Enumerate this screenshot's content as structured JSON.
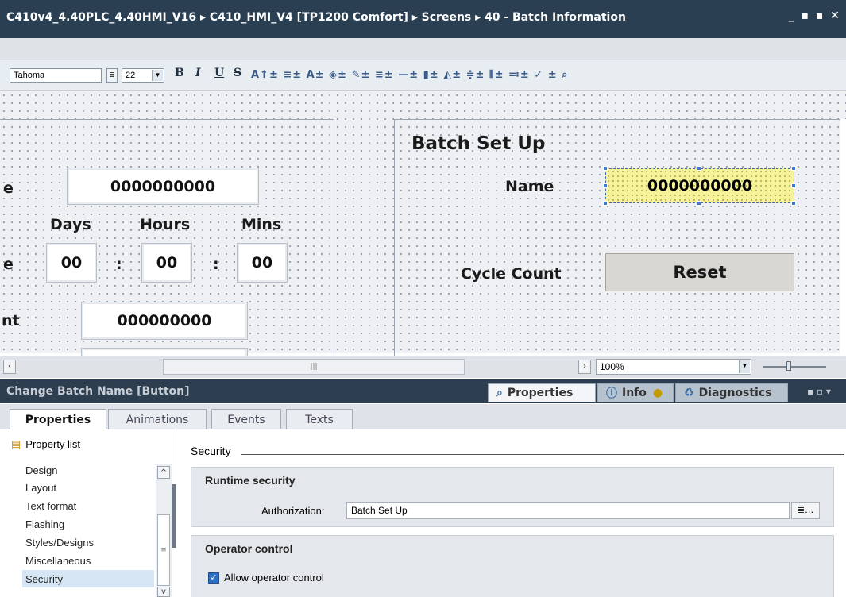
{
  "title_bar": {
    "path": "C410v4_4.40PLC_4.40HMI_V16  ▸  C410_HMI_V4 [TP1200 Comfort]  ▸  Screens  ▸  40 - Batch Information",
    "window_controls": "_ ▪ ▪ ✕"
  },
  "toolbar": {
    "font_name": "Tahoma",
    "font_size": "22",
    "bold": "B",
    "italic": "I",
    "underline": "U",
    "strike": "S",
    "more_icons": "A↑±  ≡±  A±  ◈±  ✎±  ≡±  —±  ▮±  ◭±  ≑±  ⦀±  ≕±  ✓  ±  ⌕"
  },
  "canvas": {
    "left_panel": {
      "cut_label_1": "e",
      "cut_label_2": "e",
      "cut_label_3": "nt",
      "name_value": "0000000000",
      "days_label": "Days",
      "hours_label": "Hours",
      "mins_label": "Mins",
      "days_value": "00",
      "hours_value": "00",
      "mins_value": "00",
      "sep": ":",
      "count_value": "000000000"
    },
    "right_panel": {
      "heading": "Batch Set Up",
      "name_label": "Name",
      "name_value": "0000000000",
      "cycle_label": "Cycle Count",
      "reset_label": "Reset"
    }
  },
  "scroll": {
    "zoom": "100%"
  },
  "properties_header": {
    "title": "Change Batch Name [Button]",
    "tab_properties": "Properties",
    "tab_info": "Info",
    "tab_diagnostics": "Diagnostics"
  },
  "sub_tabs": [
    "Properties",
    "Animations",
    "Events",
    "Texts"
  ],
  "nav": {
    "property_list": "Property list",
    "items": [
      "Design",
      "Layout",
      "Text format",
      "Flashing",
      "Styles/Designs",
      "Miscellaneous",
      "Security"
    ]
  },
  "security": {
    "section_title": "Security",
    "runtime_title": "Runtime security",
    "auth_label": "Authorization:",
    "auth_value": "Batch Set Up",
    "operator_title": "Operator control",
    "allow_label": "Allow operator control",
    "allow_checked": true
  }
}
